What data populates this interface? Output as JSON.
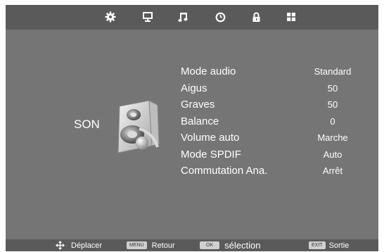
{
  "colors": {
    "screen_bg": "#757575",
    "bar_bg": "#5a5a5a",
    "text": "#ffffff"
  },
  "tabs": [
    {
      "icon": "gear-icon"
    },
    {
      "icon": "monitor-icon"
    },
    {
      "icon": "music-note-icon"
    },
    {
      "icon": "clock-icon"
    },
    {
      "icon": "lock-icon"
    },
    {
      "icon": "grid-icon"
    }
  ],
  "section": {
    "title": "SON",
    "icon": "speaker-icon"
  },
  "menu": {
    "items": [
      {
        "label": "Mode audio",
        "value": "Standard"
      },
      {
        "label": "Aigus",
        "value": "50"
      },
      {
        "label": "Graves",
        "value": "50"
      },
      {
        "label": "Balance",
        "value": "0"
      },
      {
        "label": "Volume auto",
        "value": "Marche"
      },
      {
        "label": "Mode SPDIF",
        "value": "Auto"
      },
      {
        "label": "Commutation Ana.",
        "value": "Arrêt"
      }
    ]
  },
  "footer": {
    "move": {
      "icon": "move-arrows-icon",
      "label": "Déplacer"
    },
    "back": {
      "key": "MENU",
      "label": "Retour"
    },
    "select": {
      "key": "OK",
      "label": "sélection"
    },
    "exit": {
      "key": "EXIT",
      "label": "Sortie"
    }
  }
}
